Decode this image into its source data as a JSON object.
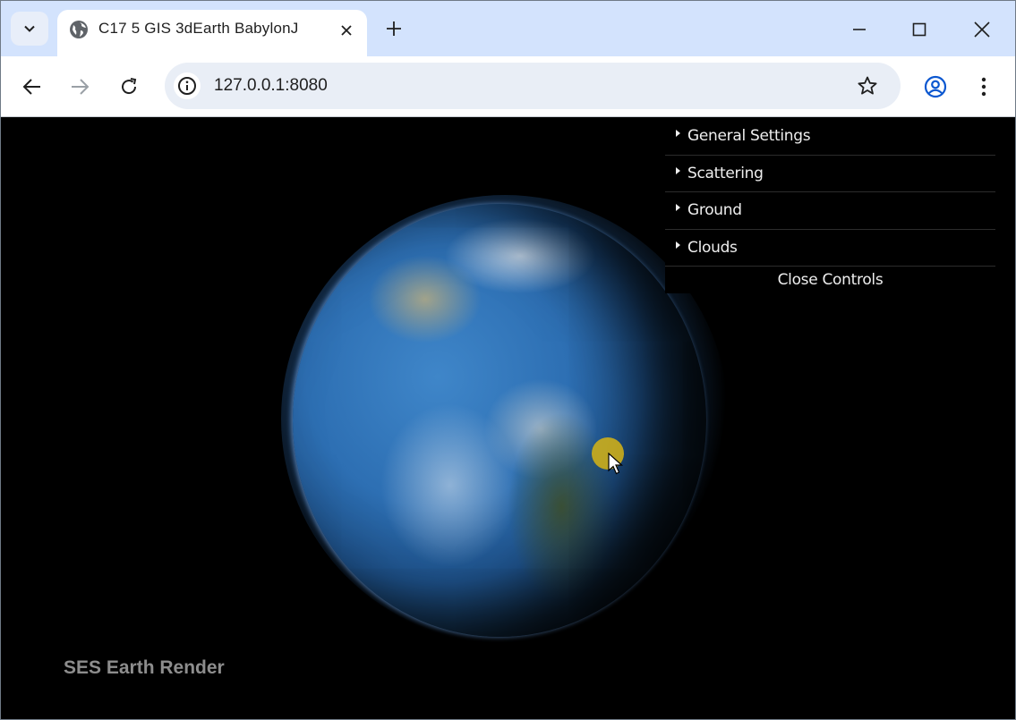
{
  "browser": {
    "tab": {
      "title": "C17 5 GIS 3dEarth BabylonJ",
      "favicon": "globe-icon"
    },
    "url": "127.0.0.1:8080",
    "colors": {
      "tabstrip": "#d3e3fd",
      "omnibox": "#e9eef6",
      "profile": "#0b57d0"
    }
  },
  "controls": {
    "folders": [
      {
        "label": "General Settings"
      },
      {
        "label": "Scattering"
      },
      {
        "label": "Ground"
      },
      {
        "label": "Clouds"
      }
    ],
    "close_label": "Close Controls"
  },
  "page": {
    "brand": "SES Earth Render",
    "cursor_highlight_color": "#d7b414"
  }
}
